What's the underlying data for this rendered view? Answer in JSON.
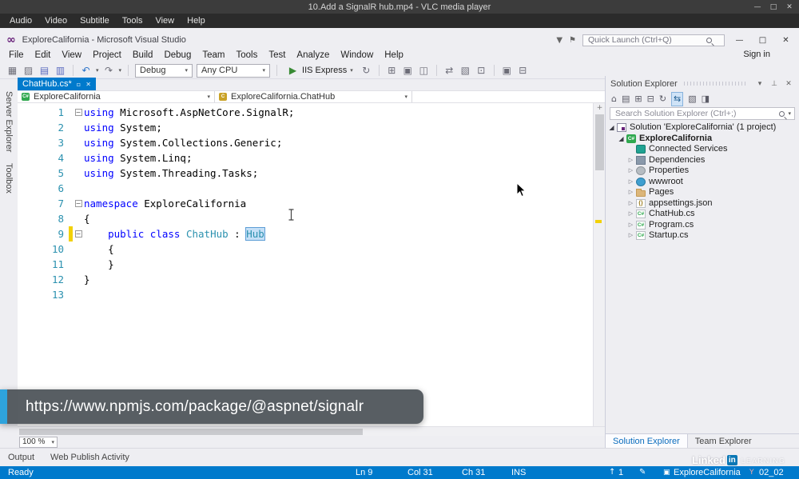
{
  "vlc": {
    "title": "10.Add a SignalR hub.mp4 - VLC media player",
    "menu": [
      "Audio",
      "Video",
      "Subtitle",
      "Tools",
      "View",
      "Help"
    ]
  },
  "vs": {
    "title": "ExploreCalifornia - Microsoft Visual Studio",
    "quick_launch": "Quick Launch (Ctrl+Q)",
    "sign_in": "Sign in",
    "menu": [
      "File",
      "Edit",
      "View",
      "Project",
      "Build",
      "Debug",
      "Team",
      "Tools",
      "Test",
      "Analyze",
      "Window",
      "Help"
    ],
    "toolbar": {
      "config": "Debug",
      "platform": "Any CPU",
      "run": "IIS Express"
    },
    "side_tabs": [
      "Server Explorer",
      "Toolbox"
    ],
    "editor": {
      "tab": "ChatHub.cs*",
      "nav_left": "ExploreCalifornia",
      "nav_right": "ExploreCalifornia.ChatHub",
      "zoom": "100 %",
      "lines": [
        {
          "n": "1",
          "fold": "-",
          "tokens": [
            {
              "c": "kw",
              "t": "using"
            },
            {
              "c": "pl",
              "t": " Microsoft.AspNetCore.SignalR;"
            }
          ]
        },
        {
          "n": "2",
          "fold": "",
          "tokens": [
            {
              "c": "kw",
              "t": "using"
            },
            {
              "c": "pl",
              "t": " System;"
            }
          ]
        },
        {
          "n": "3",
          "fold": "",
          "tokens": [
            {
              "c": "kw",
              "t": "using"
            },
            {
              "c": "pl",
              "t": " System.Collections.Generic;"
            }
          ]
        },
        {
          "n": "4",
          "fold": "",
          "tokens": [
            {
              "c": "kw",
              "t": "using"
            },
            {
              "c": "pl",
              "t": " System.Linq;"
            }
          ]
        },
        {
          "n": "5",
          "fold": "",
          "tokens": [
            {
              "c": "kw",
              "t": "using"
            },
            {
              "c": "pl",
              "t": " System.Threading.Tasks;"
            }
          ]
        },
        {
          "n": "6",
          "fold": "",
          "tokens": []
        },
        {
          "n": "7",
          "fold": "-",
          "tokens": [
            {
              "c": "kw",
              "t": "namespace"
            },
            {
              "c": "pl",
              "t": " ExploreCalifornia"
            }
          ]
        },
        {
          "n": "8",
          "fold": "",
          "tokens": [
            {
              "c": "pl",
              "t": "{"
            }
          ]
        },
        {
          "n": "9",
          "fold": "-",
          "changed": true,
          "tokens": [
            {
              "c": "pl",
              "t": "    "
            },
            {
              "c": "kw",
              "t": "public"
            },
            {
              "c": "pl",
              "t": " "
            },
            {
              "c": "kw",
              "t": "class"
            },
            {
              "c": "pl",
              "t": " "
            },
            {
              "c": "ty",
              "t": "ChatHub"
            },
            {
              "c": "pl",
              "t": " : "
            },
            {
              "c": "tybox",
              "t": "Hub"
            },
            {
              "c": "caret",
              "t": ""
            }
          ]
        },
        {
          "n": "10",
          "fold": "",
          "tokens": [
            {
              "c": "pl",
              "t": "    {"
            }
          ]
        },
        {
          "n": "11",
          "fold": "",
          "tokens": [
            {
              "c": "pl",
              "t": "    }"
            }
          ]
        },
        {
          "n": "12",
          "fold": "",
          "tokens": [
            {
              "c": "pl",
              "t": "}"
            }
          ]
        },
        {
          "n": "13",
          "fold": "",
          "tokens": []
        }
      ]
    },
    "solution": {
      "title": "Solution Explorer",
      "search_placeholder": "Search Solution Explorer (Ctrl+;)",
      "tabs": [
        "Solution Explorer",
        "Team Explorer"
      ],
      "tree": [
        {
          "level": 0,
          "arrow": "expanded",
          "icon": "solution",
          "label": "Solution 'ExploreCalifornia' (1 project)"
        },
        {
          "level": 1,
          "arrow": "expanded",
          "icon": "project",
          "label": "ExploreCalifornia",
          "bold": true
        },
        {
          "level": 2,
          "arrow": "none",
          "icon": "connected-services",
          "label": "Connected Services"
        },
        {
          "level": 2,
          "arrow": "collapsed",
          "icon": "dependencies",
          "label": "Dependencies"
        },
        {
          "level": 2,
          "arrow": "collapsed",
          "icon": "properties",
          "label": "Properties"
        },
        {
          "level": 2,
          "arrow": "collapsed",
          "icon": "wwwroot",
          "label": "wwwroot"
        },
        {
          "level": 2,
          "arrow": "collapsed",
          "icon": "folder",
          "label": "Pages"
        },
        {
          "level": 2,
          "arrow": "collapsed",
          "icon": "json",
          "label": "appsettings.json"
        },
        {
          "level": 2,
          "arrow": "collapsed",
          "icon": "cs",
          "label": "ChatHub.cs"
        },
        {
          "level": 2,
          "arrow": "collapsed",
          "icon": "cs",
          "label": "Program.cs"
        },
        {
          "level": 2,
          "arrow": "collapsed",
          "icon": "cs",
          "label": "Startup.cs"
        }
      ]
    },
    "output_tabs": [
      "Output",
      "Web Publish Activity"
    ],
    "status": {
      "ready": "Ready",
      "ln": "Ln 9",
      "col": "Col 31",
      "ch": "Ch 31",
      "ins": "INS",
      "push_count": "1",
      "project": "ExploreCalifornia",
      "branch": "02_02"
    }
  },
  "caption": {
    "text": "https://www.npmjs.com/package/@aspnet/signalr"
  },
  "watermark": {
    "p1": "Linked",
    "p2": "in",
    "p3": "LEARNING"
  },
  "icons": {
    "minimize": "—",
    "maximize": "□",
    "close": "✕",
    "logo": "∞",
    "flag": "⚑",
    "feedback": "▼",
    "newfile": "▦",
    "open": "▨",
    "save": "▤",
    "saveall": "▥",
    "undo": "↶",
    "redo": "↷",
    "caret": "▾",
    "play": "▶",
    "refresh": "↻",
    "tb1": "⊞",
    "tb2": "▣",
    "tb3": "◫",
    "tb4": "⇄",
    "tb5": "▧",
    "tb6": "⊡",
    "tab_popout": "▫",
    "tab_close": "✕",
    "chevron": "▾",
    "pin": "⊥",
    "home": "⌂",
    "se1": "▤",
    "se2": "⊞",
    "se3": "⊟",
    "se4": "↻",
    "se5": "⇆",
    "se6": "▧",
    "se7": "◨",
    "arrow_collapsed": "▷",
    "arrow_expanded": "◢",
    "fold_minus": "−",
    "split": "+",
    "up": "↑",
    "pencil": "✎",
    "repo": "▣",
    "branch": "Y"
  },
  "colors": {
    "accent": "#007acc",
    "keyword": "#0000ff",
    "type": "#2b91af",
    "status_bar": "#007acc",
    "caption_accent": "#2ea3dc"
  }
}
